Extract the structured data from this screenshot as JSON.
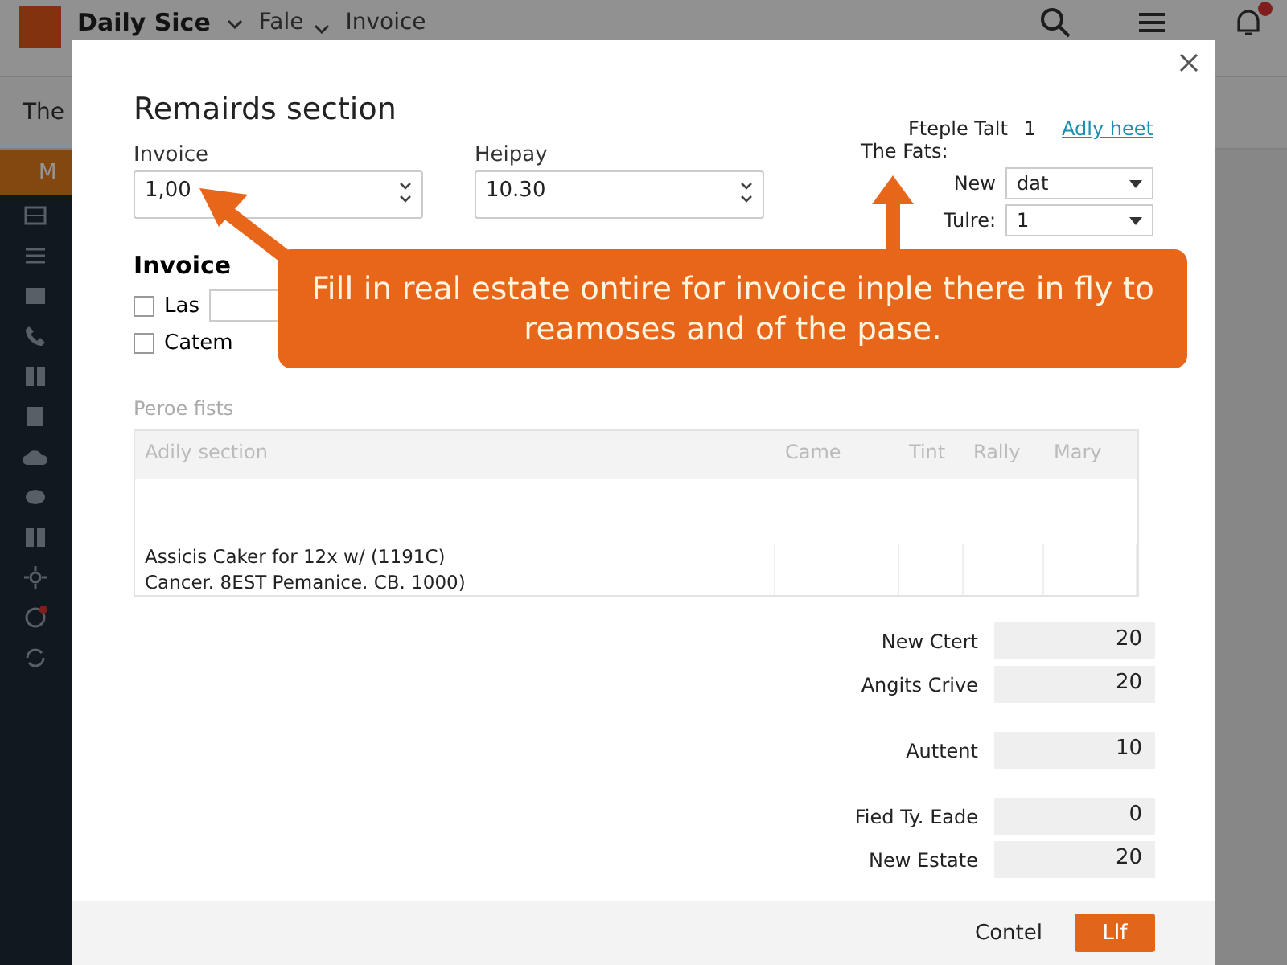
{
  "top_bar": {
    "app_name": "Daily Sice",
    "menus": [
      "Fale",
      "Invoice"
    ],
    "notification_badge": true
  },
  "sub_bar": {
    "title": "The"
  },
  "sidebar": {
    "header": "M",
    "items": [
      {
        "kind": "list"
      },
      {
        "kind": "lines"
      },
      {
        "kind": "card"
      },
      {
        "kind": "phone"
      },
      {
        "kind": "grid"
      },
      {
        "kind": "doc"
      },
      {
        "kind": "cloud"
      },
      {
        "kind": "chat"
      },
      {
        "kind": "grid"
      },
      {
        "kind": "gear"
      },
      {
        "kind": "alert"
      },
      {
        "kind": "sync"
      }
    ]
  },
  "dialog": {
    "title": "Remairds section",
    "fields": [
      {
        "label": "Invoice",
        "value": "1,00"
      },
      {
        "label": "Heipay",
        "value": "10.30"
      }
    ],
    "right_panel": {
      "label": "Fteple Talt",
      "count": "1",
      "link": "Adly heet",
      "subtitle": "The Fats:",
      "selects": [
        {
          "label": "New",
          "value": "dat"
        },
        {
          "label": "Tulre:",
          "value": "1"
        }
      ]
    },
    "invoice_section": {
      "heading": "Invoice",
      "options": [
        {
          "label": "Las",
          "checked": false,
          "kind": "input"
        },
        {
          "label": "Catem",
          "checked": false,
          "kind": "plain"
        }
      ]
    },
    "callout": {
      "text": "Fill in real estate ontire for invoice inple there in fly to reamoses and of the pase."
    },
    "table": {
      "caption": "Peroe fists",
      "columns": [
        "Adily section",
        "Came",
        "Tint",
        "Rally",
        "Mary"
      ],
      "rows": [
        [
          "Assicis Caker for 12x w/ (1191C)",
          "",
          "",
          "",
          ""
        ],
        [
          "Cancer. 8EST Pemanice. CB. 1000)",
          "",
          "",
          "",
          ""
        ]
      ]
    },
    "total_groups": [
      [
        {
          "label": "New Ctert",
          "value": "20"
        },
        {
          "label": "Angits Crive",
          "value": "20"
        }
      ],
      [
        {
          "label": "Auttent",
          "value": "10"
        }
      ],
      [
        {
          "label": "Fied Ty. Eade",
          "value": "0"
        },
        {
          "label": "New Estate",
          "value": "20"
        }
      ]
    ],
    "buttons": {
      "cancel": "Contel",
      "ok": "Llf"
    }
  }
}
